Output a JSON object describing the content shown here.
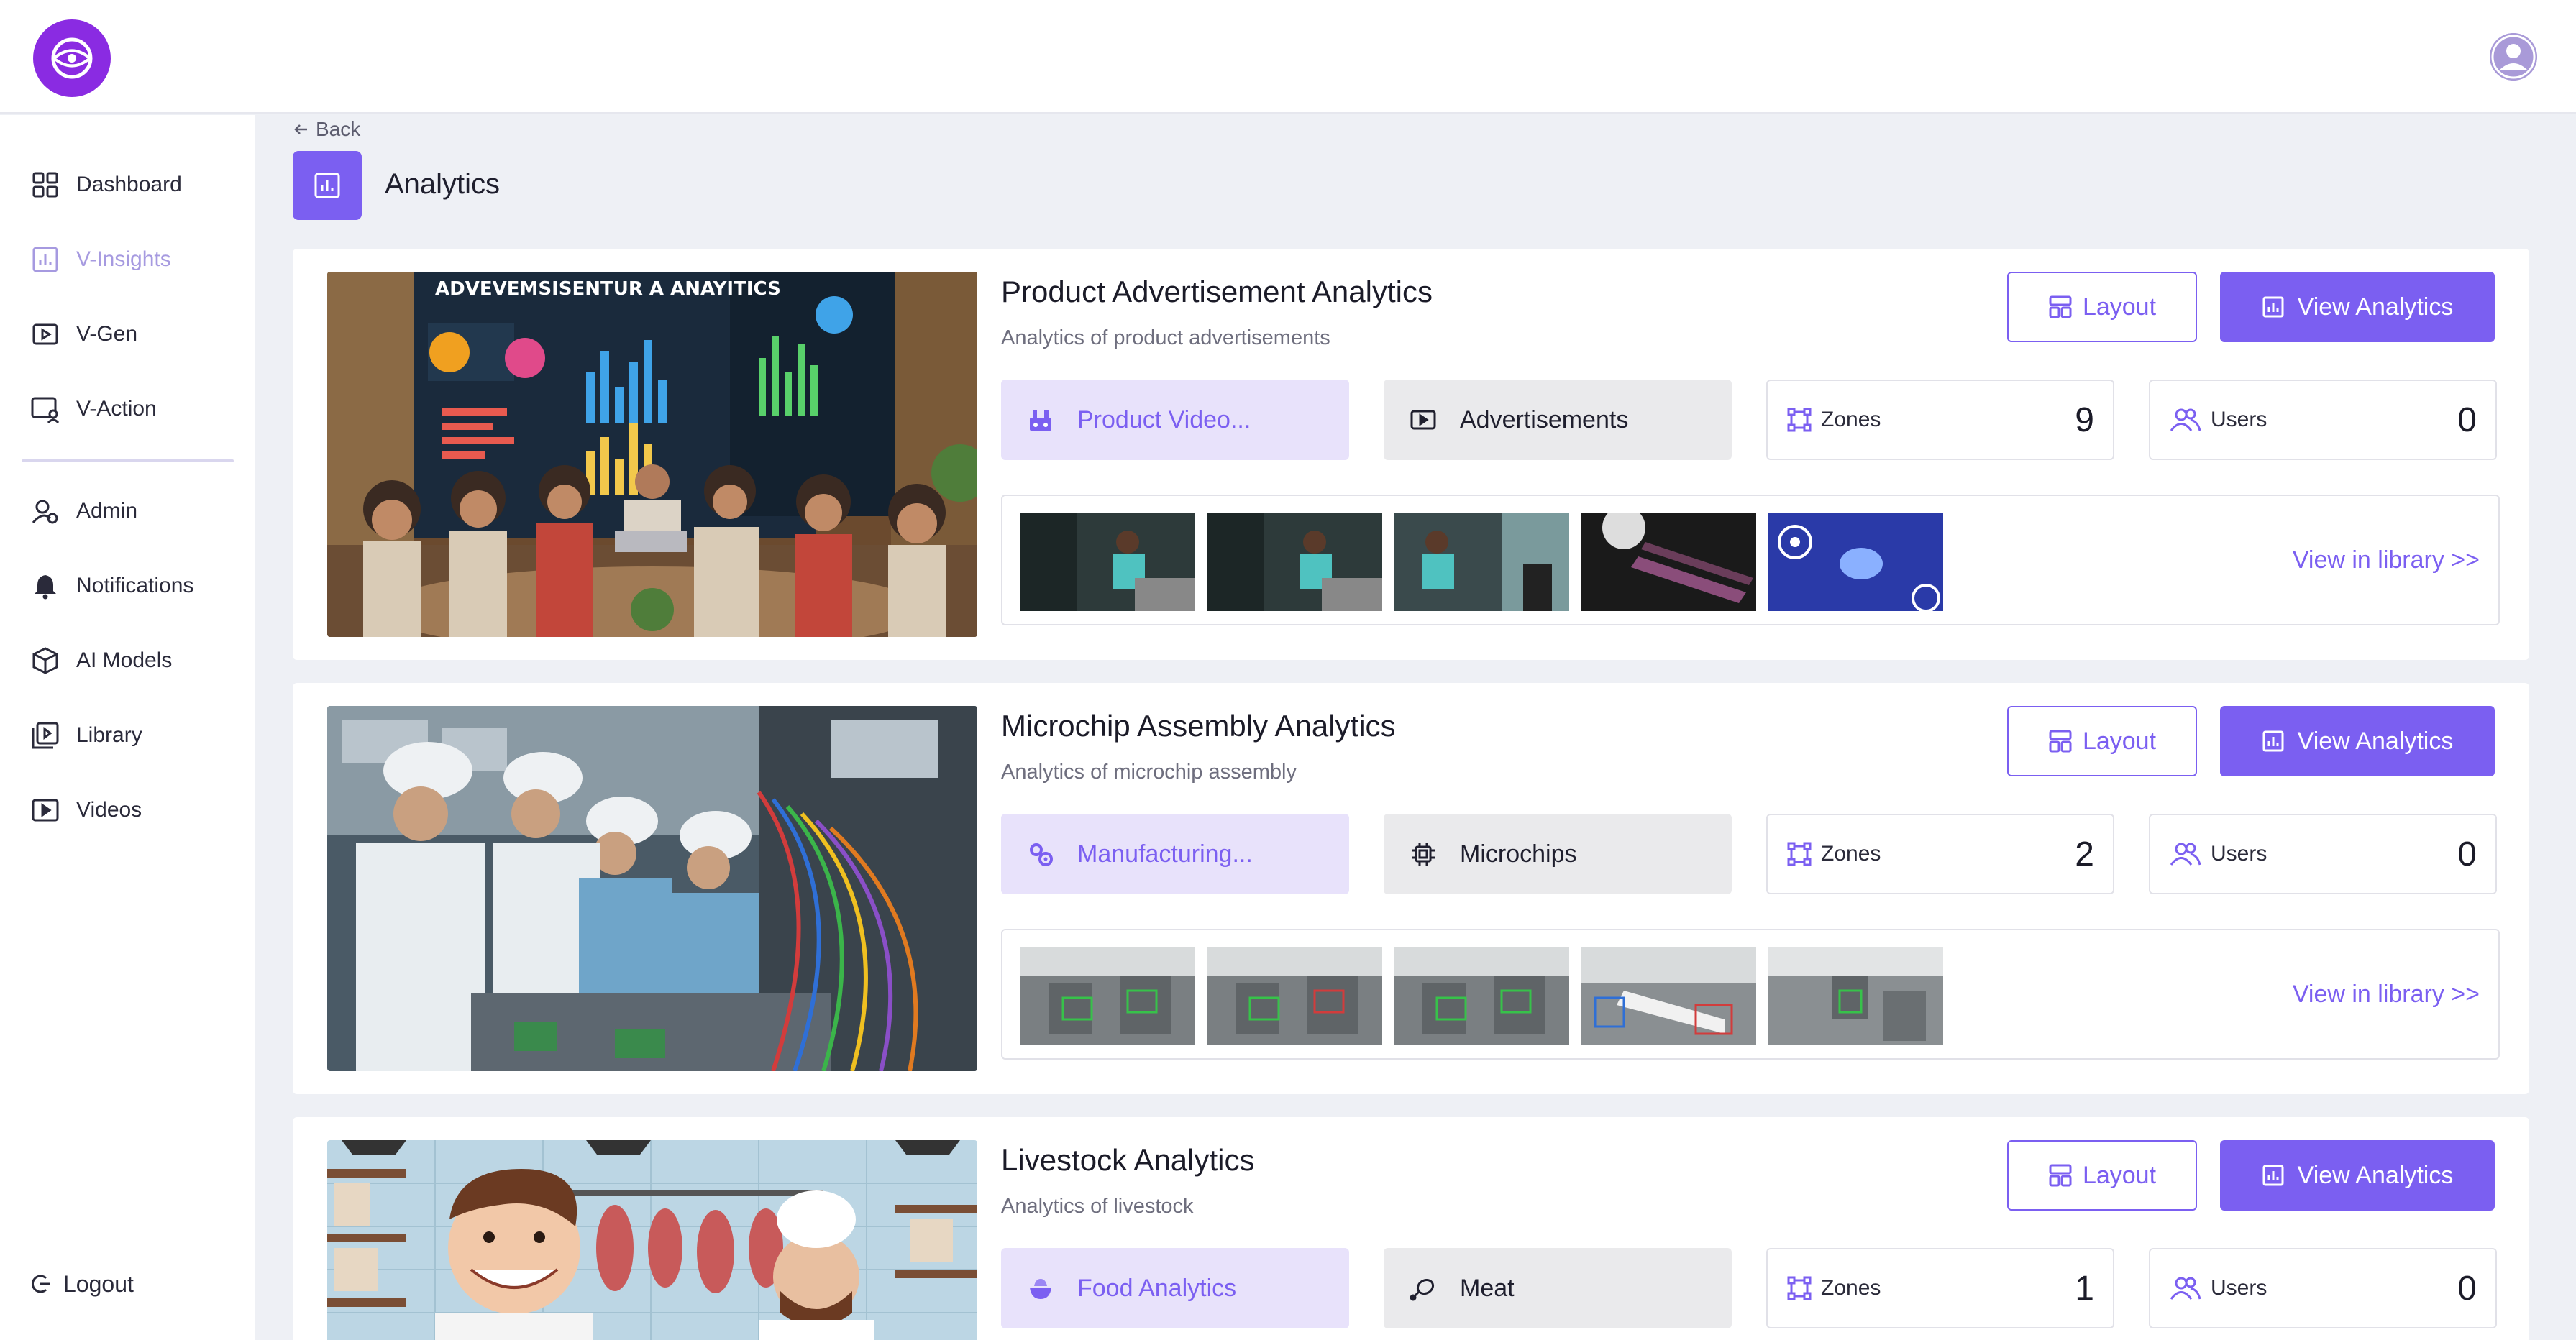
{
  "header": {
    "logo_icon": "globe-eye-icon",
    "avatar_icon": "user-avatar-icon"
  },
  "sidebar": {
    "items": [
      {
        "label": "Dashboard",
        "icon": "grid-icon"
      },
      {
        "label": "V-Insights",
        "icon": "chart-icon",
        "active": true
      },
      {
        "label": "V-Gen",
        "icon": "play-square-icon"
      },
      {
        "label": "V-Action",
        "icon": "monitor-user-icon"
      },
      {
        "label": "Admin",
        "icon": "user-gear-icon"
      },
      {
        "label": "Notifications",
        "icon": "bell-icon"
      },
      {
        "label": "AI Models",
        "icon": "cube-icon"
      },
      {
        "label": "Library",
        "icon": "library-icon"
      },
      {
        "label": "Videos",
        "icon": "video-icon"
      }
    ],
    "logout_label": "Logout"
  },
  "page": {
    "back_label": "Back",
    "title": "Analytics"
  },
  "cards": [
    {
      "title": "Product Advertisement Analytics",
      "subtitle": "Analytics of product advertisements",
      "layout_label": "Layout",
      "view_label": "View Analytics",
      "category": "Product Video...",
      "tag": "Advertisements",
      "zones_label": "Zones",
      "zones": "9",
      "users_label": "Users",
      "users": "0",
      "library_link": "View in library >>",
      "image_caption": "ADVEVEMSISENTUR A ANAYITICS"
    },
    {
      "title": "Microchip Assembly Analytics",
      "subtitle": "Analytics of microchip assembly",
      "layout_label": "Layout",
      "view_label": "View Analytics",
      "category": "Manufacturing...",
      "tag": "Microchips",
      "zones_label": "Zones",
      "zones": "2",
      "users_label": "Users",
      "users": "0",
      "library_link": "View in library >>"
    },
    {
      "title": "Livestock Analytics",
      "subtitle": "Analytics of livestock",
      "layout_label": "Layout",
      "view_label": "View Analytics",
      "category": "Food Analytics",
      "tag": "Meat",
      "zones_label": "Zones",
      "zones": "1",
      "users_label": "Users",
      "users": "0"
    }
  ],
  "colors": {
    "accent": "#7b5ff1",
    "accent_light": "#e8e2fb",
    "logo": "#8a2be2",
    "background": "#eef0f5"
  }
}
